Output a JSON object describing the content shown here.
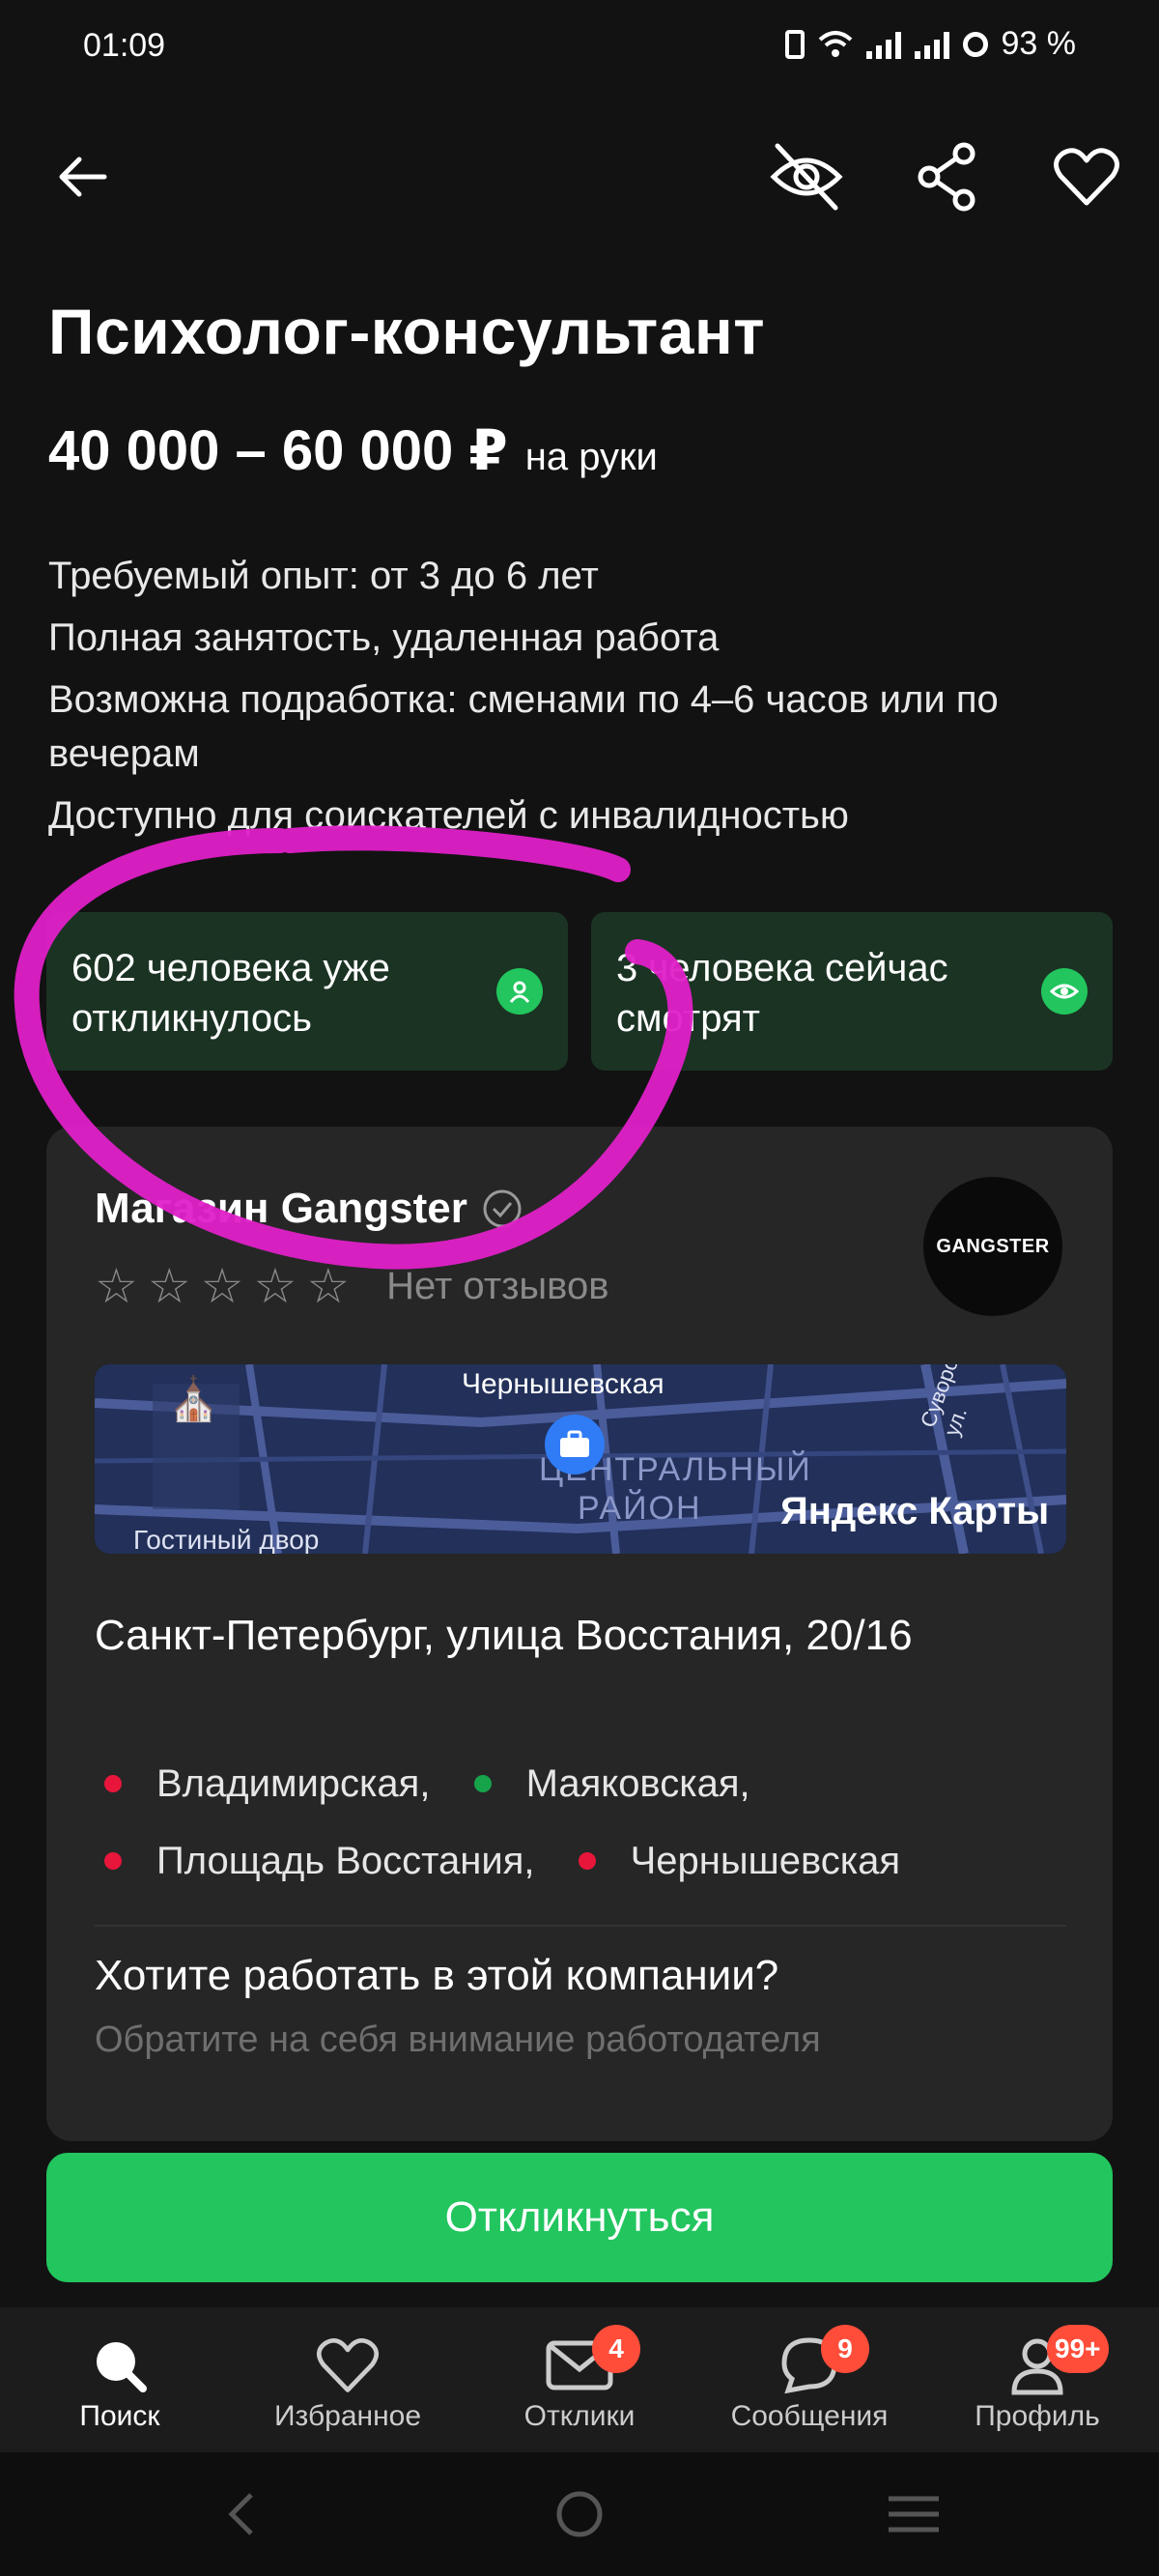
{
  "status_bar": {
    "time": "01:09",
    "battery": "93 %"
  },
  "header": {
    "icons": [
      "back-arrow-icon",
      "hide-eye-icon",
      "share-icon",
      "heart-icon"
    ]
  },
  "vacancy": {
    "title": "Психолог-консультант",
    "salary": "40 000 – 60 000 ₽",
    "salary_suffix": "на руки",
    "details": [
      "Требуемый опыт: от 3 до 6 лет",
      "Полная занятость, удаленная работа",
      "Возможна подработка: сменами по 4–6 часов или по вечерам",
      "Доступно для соискателей с инвалидностью"
    ]
  },
  "stats": {
    "responded": "602 человека уже откликнулось",
    "viewing": "3 человека сейчас смотрят"
  },
  "company": {
    "name": "Магазин Gangster",
    "reviews": "Нет отзывов",
    "rating_stars": 0,
    "logo_text": "GANGSTER",
    "map": {
      "label_top": "Чернышевская",
      "label_district_1": "ЦЕНТРАЛЬНЫЙ",
      "label_district_2": "РАЙОН",
      "label_bottom": "Гостиный двор",
      "label_street": "Суворовская ул.",
      "brand": "Яндекс Карты"
    },
    "address": "Санкт-Петербург, улица Восстания, 20/16",
    "metro": [
      {
        "name": "Владимирская,",
        "color": "#e8163b"
      },
      {
        "name": "Маяковская,",
        "color": "#16a34a"
      },
      {
        "name": "Площадь Восстания,",
        "color": "#e8163b"
      },
      {
        "name": "Чернышевская",
        "color": "#e8163b"
      }
    ],
    "cta_question": "Хотите работать в этой компании?",
    "cta_sub": "Обратите на себя внимание работодателя"
  },
  "apply_button": "Откликнуться",
  "tabbar": {
    "items": [
      {
        "label": "Поиск",
        "icon": "search-icon",
        "badge": ""
      },
      {
        "label": "Избранное",
        "icon": "heart-icon",
        "badge": ""
      },
      {
        "label": "Отклики",
        "icon": "mail-icon",
        "badge": "4"
      },
      {
        "label": "Сообщения",
        "icon": "chat-icon",
        "badge": "9"
      },
      {
        "label": "Профиль",
        "icon": "profile-icon",
        "badge": "99+"
      }
    ]
  },
  "colors": {
    "accent": "#22c55e",
    "highlight": "#e020c8",
    "badge": "#ff4d3a"
  }
}
